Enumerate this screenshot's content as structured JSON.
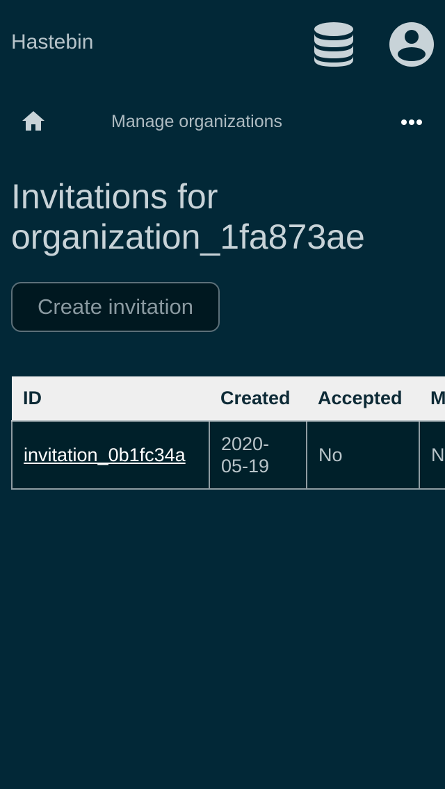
{
  "header": {
    "brand": "Hastebin",
    "database_icon": "database-icon",
    "account_icon": "user-circle-icon"
  },
  "nav": {
    "home_icon": "home-icon",
    "title": "Manage organizations",
    "more_icon": "more-horizontal-icon"
  },
  "main": {
    "title_line1": "Invitations for",
    "title_line2": "organization_1fa873ae",
    "create_button": "Create invitation"
  },
  "table": {
    "columns": [
      "ID",
      "Created",
      "Accepted",
      "M"
    ],
    "rows": [
      {
        "id": "invitation_0b1fc34a",
        "created_line1": "2020-",
        "created_line2": "05-19",
        "accepted": "No",
        "more": "N"
      }
    ]
  },
  "colors": {
    "background": "#022837",
    "header_row": "#efefef",
    "cell_background": "#00202a",
    "text": "#c8d3d8",
    "link": "#ffffff"
  }
}
